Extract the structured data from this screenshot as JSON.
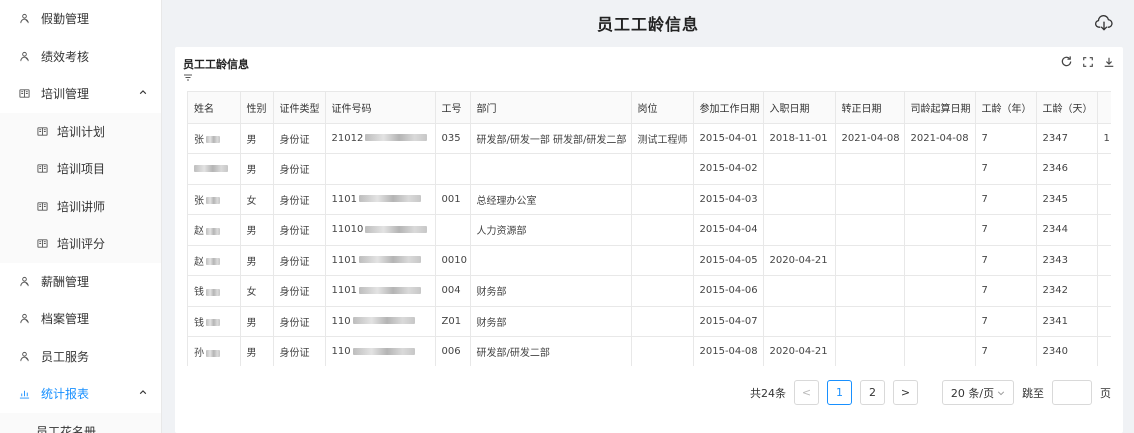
{
  "sidebar": {
    "items": [
      {
        "label": "假勤管理",
        "icon": "user-icon"
      },
      {
        "label": "绩效考核",
        "icon": "user-icon"
      },
      {
        "label": "培训管理",
        "icon": "book-icon",
        "expanded": true
      },
      {
        "label": "培训计划",
        "icon": "book-icon",
        "sub": true
      },
      {
        "label": "培训项目",
        "icon": "book-icon",
        "sub": true
      },
      {
        "label": "培训讲师",
        "icon": "book-icon",
        "sub": true
      },
      {
        "label": "培训评分",
        "icon": "book-icon",
        "sub": true
      },
      {
        "label": "薪酬管理",
        "icon": "user-icon"
      },
      {
        "label": "档案管理",
        "icon": "user-icon"
      },
      {
        "label": "员工服务",
        "icon": "user-icon"
      },
      {
        "label": "统计报表",
        "icon": "chart-icon",
        "expanded": true,
        "active": true
      },
      {
        "label": "员工花名册",
        "icon": "none",
        "sub": true
      }
    ],
    "active_color": "#1890ff"
  },
  "header": {
    "title": "员工工龄信息",
    "cloud_icon": "cloud-download-icon"
  },
  "card": {
    "title": "员工工龄信息",
    "toolbar": [
      "refresh-icon",
      "fullscreen-icon",
      "download-icon"
    ]
  },
  "table": {
    "columns": [
      "姓名",
      "性别",
      "证件类型",
      "证件号码",
      "工号",
      "部门",
      "岗位",
      "参加工作日期",
      "入职日期",
      "转正日期",
      "司龄起算日期",
      "工龄（年）",
      "工龄（天）",
      ""
    ],
    "rows": [
      [
        "张",
        "男",
        "身份证",
        "21012",
        "035",
        "研发部/研发一部 研发部/研发二部",
        "测试工程师",
        "2015-04-01",
        "2018-11-01",
        "2021-04-08",
        "2021-04-08",
        "7",
        "2347",
        "1"
      ],
      [
        "",
        "男",
        "身份证",
        "",
        "",
        "",
        "",
        "2015-04-02",
        "",
        "",
        "",
        "7",
        "2346",
        ""
      ],
      [
        "张",
        "女",
        "身份证",
        "1101",
        "001",
        "总经理办公室",
        "",
        "2015-04-03",
        "",
        "",
        "",
        "7",
        "2345",
        ""
      ],
      [
        "赵",
        "男",
        "身份证",
        "11010",
        "",
        "人力资源部",
        "",
        "2015-04-04",
        "",
        "",
        "",
        "7",
        "2344",
        ""
      ],
      [
        "赵",
        "男",
        "身份证",
        "1101",
        "0010",
        "",
        "",
        "2015-04-05",
        "2020-04-21",
        "",
        "",
        "7",
        "2343",
        ""
      ],
      [
        "钱",
        "女",
        "身份证",
        "1101",
        "004",
        "财务部",
        "",
        "2015-04-06",
        "",
        "",
        "",
        "7",
        "2342",
        ""
      ],
      [
        "钱",
        "男",
        "身份证",
        "110",
        "Z01",
        "财务部",
        "",
        "2015-04-07",
        "",
        "",
        "",
        "7",
        "2341",
        ""
      ],
      [
        "孙",
        "男",
        "身份证",
        "110",
        "006",
        "研发部/研发二部",
        "",
        "2015-04-08",
        "2020-04-21",
        "",
        "",
        "7",
        "2340",
        ""
      ],
      [
        "",
        "",
        "",
        "",
        "",
        "",
        "",
        "",
        "",
        "",
        "",
        "",
        "",
        ""
      ]
    ]
  },
  "pagination": {
    "total": "共24条",
    "prev": "<",
    "pages": [
      "1",
      "2"
    ],
    "current": "1",
    "next": ">",
    "page_size": "20 条/页",
    "jump_label": "跳至",
    "jump_suffix": "页",
    "jump_value": ""
  }
}
